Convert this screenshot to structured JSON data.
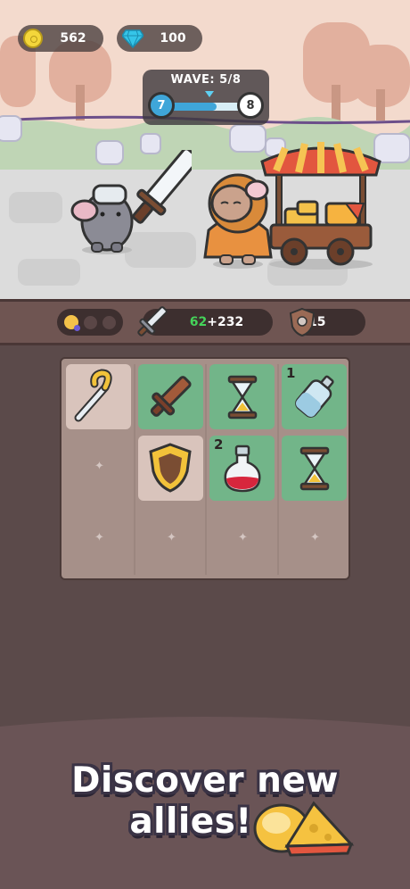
{
  "hud": {
    "coins": "562",
    "gems": "100"
  },
  "wave": {
    "title": "WAVE: 5/8",
    "current": "7",
    "next": "8",
    "progress": 0.62
  },
  "stats": {
    "attack_base": "62",
    "attack_bonus": "+232",
    "defense": "15",
    "cheese_slots_filled": 1,
    "cheese_slots_total": 3
  },
  "inventory": {
    "slots": [
      {
        "item": "crook-staff",
        "style": "tan",
        "count": ""
      },
      {
        "item": "wooden-sword",
        "style": "green",
        "count": ""
      },
      {
        "item": "hourglass",
        "style": "green",
        "count": ""
      },
      {
        "item": "bottle",
        "style": "green",
        "count": "1"
      },
      {
        "item": "empty",
        "style": "empty",
        "count": ""
      },
      {
        "item": "gold-shield",
        "style": "tan",
        "count": ""
      },
      {
        "item": "red-potion",
        "style": "green",
        "count": "2"
      },
      {
        "item": "hourglass",
        "style": "green",
        "count": ""
      }
    ]
  },
  "promo": {
    "line1": "Discover new",
    "line2": "allies!"
  },
  "colors": {
    "sky": "#f2d9cc",
    "ground": "#dedede",
    "stats_bar": "#6f5552",
    "slot_green": "#72b589",
    "slot_tan": "#d9c4bc",
    "attack_green": "#45d35a",
    "background": "#5b4a4a"
  }
}
